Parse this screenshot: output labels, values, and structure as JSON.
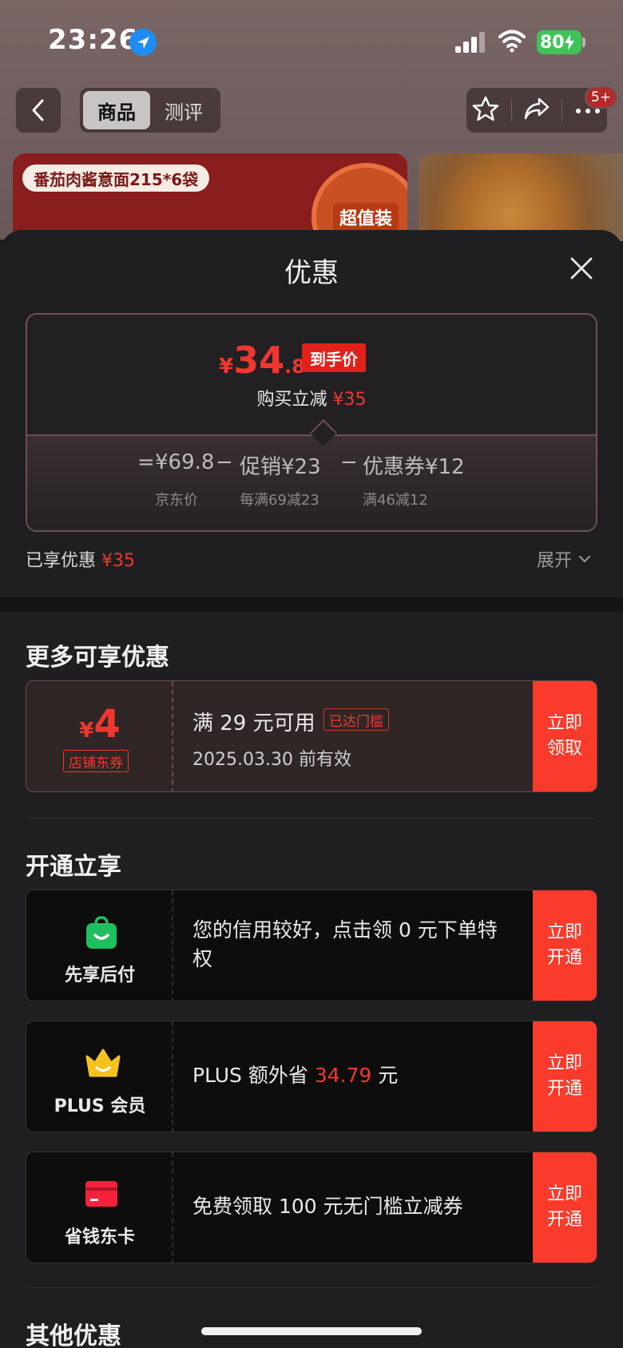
{
  "status_bar": {
    "time": "23:26",
    "battery": "80",
    "icons": [
      "location-icon",
      "signal-icon",
      "wifi-icon",
      "battery-charging-icon"
    ]
  },
  "nav": {
    "tabs": [
      {
        "label": "商品",
        "active": true
      },
      {
        "label": "测评",
        "active": false
      }
    ],
    "badge": "5+",
    "icons": [
      "back-icon",
      "star-icon",
      "share-icon",
      "more-icon"
    ]
  },
  "banner": {
    "tag": "番茄肉酱意面215*6袋",
    "seal_text": "超值装",
    "colors": {
      "banner_bg": "#8a1d1d",
      "seal": "#c85022"
    }
  },
  "sheet": {
    "title": "优惠",
    "price": {
      "symbol": "¥",
      "integer": "34",
      "decimal": ".8",
      "tag": "到手价",
      "reduce_label": "购买立减",
      "reduce_value": "¥35"
    },
    "calc": {
      "equals": "=",
      "minus": "−",
      "items": [
        {
          "value": "¥69.8",
          "sub": "京东价"
        },
        {
          "value": "促销¥23",
          "sub": "每满69减23"
        },
        {
          "value": "优惠券¥12",
          "sub": "满46减12"
        }
      ]
    },
    "enjoyed_label": "已享优惠",
    "enjoyed_value": "¥35",
    "expand_label": "展开"
  },
  "more": {
    "title": "更多可享优惠",
    "coupon": {
      "symbol": "¥",
      "amount": "4",
      "type": "店铺东券",
      "condition": "满 29 元可用",
      "status": "已达门槛",
      "validity": "2025.03.30 前有效",
      "button": "立即领取"
    }
  },
  "open": {
    "title": "开通立享",
    "items": [
      {
        "icon": "bag-icon",
        "name": "先享后付",
        "desc": "您的信用较好，点击领 0 元下单特权",
        "button": "立即开通"
      },
      {
        "icon": "crown-icon",
        "name": "PLUS 会员",
        "desc_pre": "PLUS 额外省 ",
        "desc_highlight": "34.79",
        "desc_post": " 元",
        "button": "立即开通"
      },
      {
        "icon": "card-icon",
        "name": "省钱东卡",
        "desc": "免费领取 100 元无门槛立减券",
        "button": "立即开通"
      }
    ]
  },
  "other": {
    "title": "其他优惠"
  },
  "colors": {
    "accent_red": "#f0372f",
    "button_red": "#fa3b2b",
    "sheet_bg": "#1f1f21",
    "card_dark": "#0d0d0d",
    "green": "#1fbf5f",
    "gold": "#f7c21e"
  }
}
